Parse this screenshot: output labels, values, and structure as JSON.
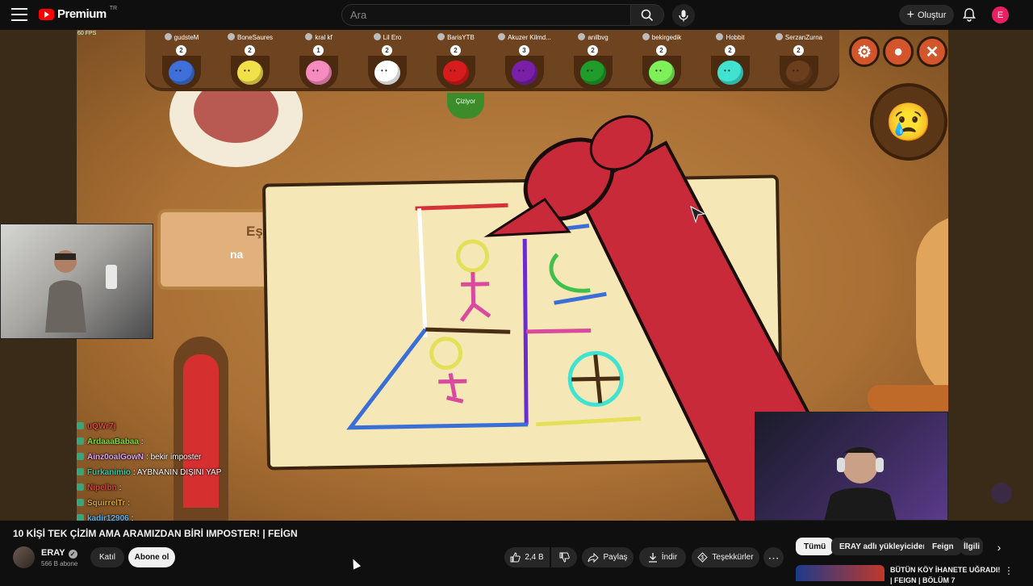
{
  "header": {
    "logo_text": "Premium",
    "logo_badge": "TR",
    "search_placeholder": "Ara",
    "create_label": "Oluştur",
    "avatar_letter": "E"
  },
  "player": {
    "fps_label": "60 FPS",
    "game_players": [
      {
        "name": "gudsteM",
        "score": "2",
        "color": "#3f6fd8"
      },
      {
        "name": "BoneSaures",
        "score": "2",
        "color": "#f2e04a"
      },
      {
        "name": "kral kf",
        "score": "1",
        "color": "#f58bbf"
      },
      {
        "name": "Lil Ero",
        "score": "2",
        "color": "#ffffff"
      },
      {
        "name": "BarisYTB",
        "score": "2",
        "color": "#d81b1b"
      },
      {
        "name": "Akuzer Kilmd...",
        "score": "3",
        "color": "#7a1fa8"
      },
      {
        "name": "anilbvg",
        "score": "2",
        "color": "#1f9c2a"
      },
      {
        "name": "bekirgedik",
        "score": "2",
        "color": "#7ef05a"
      },
      {
        "name": "Hobbit",
        "score": "2",
        "color": "#3fe3d0"
      },
      {
        "name": "SerzanZurna",
        "score": "2",
        "color": "#6b3f1e"
      }
    ],
    "drawing_label": "Çiziyor",
    "items_panel_title": "Eşyalar",
    "items_panel_sub": "na",
    "chat": [
      {
        "user": "uQWr7j",
        "msg": "",
        "color": "#e0463c"
      },
      {
        "user": "ArdaaaBabaa",
        "msg": ":",
        "color": "#7cdc3a"
      },
      {
        "user": "Ainz0oalGowN",
        "msg": ": bekir imposter",
        "color": "#d9a0f5"
      },
      {
        "user": "Furkanimio",
        "msg": ": AYBNANIN DIŞINI YAP",
        "color": "#35c7a8"
      },
      {
        "user": "Nipelbn",
        "msg": ":",
        "color": "#e0463c"
      },
      {
        "user": "SquirrelTr",
        "msg": ":",
        "color": "#d4a43a"
      },
      {
        "user": "kadir12906",
        "msg": ":",
        "color": "#5ab0f0"
      }
    ]
  },
  "video": {
    "title": "10 KİŞİ TEK ÇİZİM AMA ARAMIZDAN BİRİ IMPOSTER! | FEİGN",
    "channel_name": "ERAY",
    "subscribers": "566 B abone",
    "join_label": "Katıl",
    "subscribe_label": "Abone ol",
    "likes": "2,4 B",
    "share_label": "Paylaş",
    "download_label": "İndir",
    "thanks_label": "Teşekkürler"
  },
  "sidebar": {
    "chips": [
      "Tümü",
      "ERAY adlı yükleyiciden",
      "Feign",
      "İlgili"
    ],
    "rec_title": "BÜTÜN KÖY İHANETE UĞRADI! | FEIGN | BÖLÜM 7"
  },
  "colors": {
    "accent": "#ff0000",
    "background": "#0f0f0f"
  }
}
